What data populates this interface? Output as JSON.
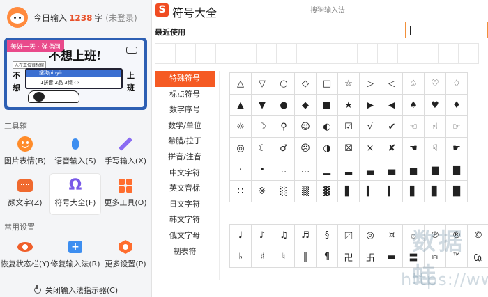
{
  "sidebar": {
    "today_prefix": "今日输入",
    "today_count": "1238",
    "today_unit": "字",
    "login_status": "(未登录)",
    "banner": {
      "tag": "美好一天 · 弹指间",
      "title": "不想上班!",
      "small_label": "人在工位很想摆",
      "input_text": "搜狗pinyin",
      "candidates": "1拼音 2品 3频 ‹ ›",
      "side_left_top": "不",
      "side_left_bottom": "想",
      "side_right_top": "上",
      "side_right_bottom": "班"
    },
    "toolbox_title": "工具箱",
    "tools": [
      {
        "label": "图片表情(B)",
        "icon": "smiley-icon"
      },
      {
        "label": "语音输入(S)",
        "icon": "microphone-icon"
      },
      {
        "label": "手写输入(X)",
        "icon": "pen-icon"
      },
      {
        "label": "颜文字(Z)",
        "icon": "emoticon-icon"
      },
      {
        "label": "符号大全(F)",
        "icon": "omega-icon"
      },
      {
        "label": "更多工具(O)",
        "icon": "grid-icon"
      }
    ],
    "settings_title": "常用设置",
    "settings": [
      {
        "label": "恢复状态栏(Y)",
        "icon": "eye-icon"
      },
      {
        "label": "修复输入法(R)",
        "icon": "repair-kit-icon"
      },
      {
        "label": "更多设置(P)",
        "icon": "hexagon-gear-icon"
      }
    ],
    "close_indicator": "关闭输入法指示器(C)"
  },
  "symbols_window": {
    "logo_char": "S",
    "title": "符号大全",
    "subtitle": "搜狗输入法",
    "recent_label": "最近使用",
    "search_placeholder": "",
    "categories": [
      "特殊符号",
      "标点符号",
      "数字序号",
      "数学/单位",
      "希腊/拉丁",
      "拼音/注音",
      "中文字符",
      "英文音标",
      "日文字符",
      "韩文字符",
      "俄文字母",
      "制表符"
    ],
    "active_category": "特殊符号",
    "grid_main": [
      [
        "△",
        "▽",
        "○",
        "◇",
        "□",
        "☆",
        "▷",
        "◁",
        "♤",
        "♡",
        "♢"
      ],
      [
        "▲",
        "▼",
        "●",
        "◆",
        "■",
        "★",
        "▶",
        "◀",
        "♠",
        "♥",
        "♦"
      ],
      [
        "☼",
        "☽",
        "♀",
        "☺",
        "◐",
        "☑",
        "√",
        "✔",
        "☜",
        "☝",
        "☞"
      ],
      [
        "◎",
        "☾",
        "♂",
        "☹",
        "◑",
        "☒",
        "×",
        "✘",
        "☚",
        "☟",
        "☛"
      ],
      [
        "·",
        "•",
        "‥",
        "…",
        "▁",
        "▂",
        "▃",
        "▄",
        "▅",
        "▆",
        "▇"
      ],
      [
        "∷",
        "※",
        "░",
        "▒",
        "▓",
        "▌",
        "▍",
        "▎",
        "▋",
        "▊",
        "█"
      ]
    ],
    "grid_second": [
      [
        "♩",
        "♪",
        "♫",
        "♬",
        "§",
        "〼",
        "◎",
        "¤",
        "۞",
        "℗",
        "®",
        "©"
      ],
      [
        "♭",
        "♯",
        "♮",
        "‖",
        "¶",
        "卍",
        "卐",
        "▬",
        "〓",
        "℡",
        "™",
        "㏇"
      ]
    ],
    "watermark": "数据蛙",
    "watermark_url": "https://www.shujuwa.net"
  }
}
